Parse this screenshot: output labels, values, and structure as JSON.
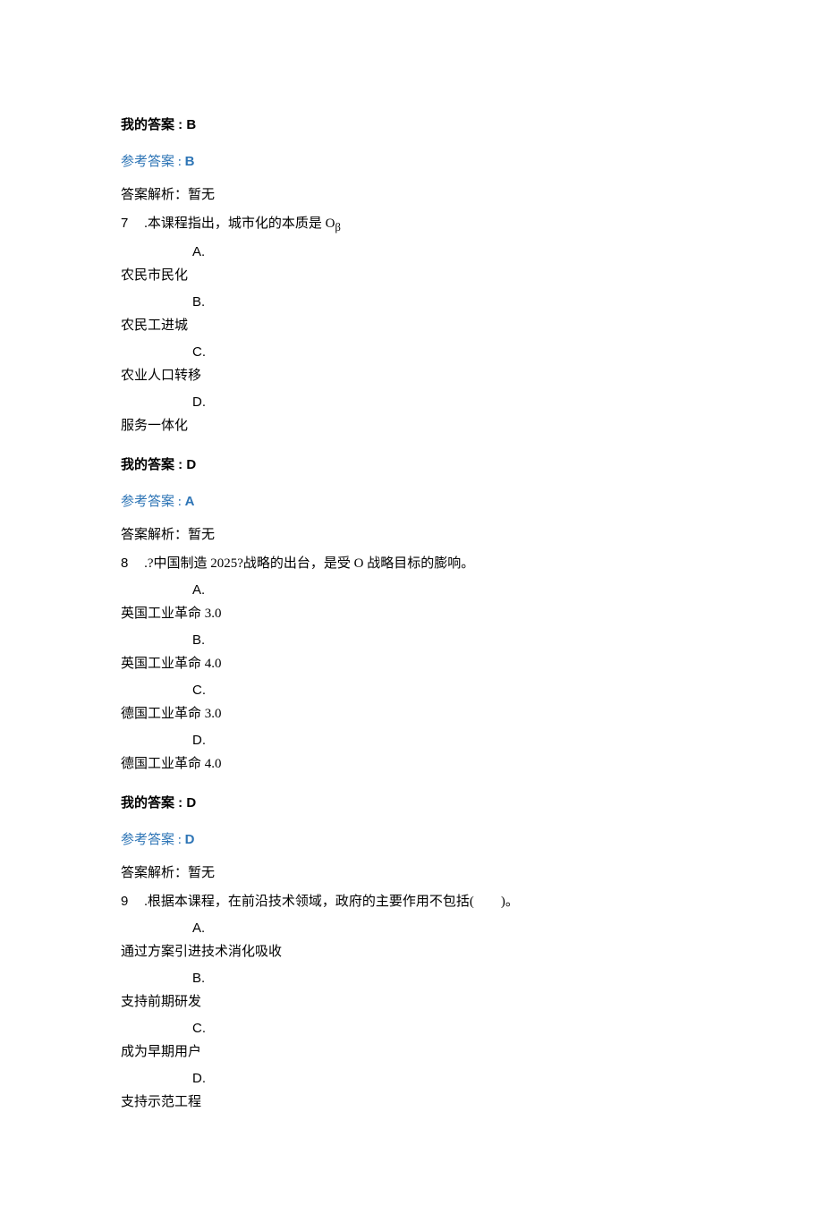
{
  "labels": {
    "my_answer": "我的答案 : ",
    "ref_answer": "参考答案 : ",
    "analysis_prefix": "答案解析：",
    "analysis_value": "暂无"
  },
  "q6": {
    "my_answer": "B",
    "ref_answer": "B"
  },
  "q7": {
    "num": "7",
    "stem_pre": "  .本课程指出，城市化的本质是 O",
    "stem_sub": "β",
    "options": {
      "A": {
        "letter": "A.",
        "text": "农民市民化"
      },
      "B": {
        "letter": "B.",
        "text": "农民工进城"
      },
      "C": {
        "letter": "C.",
        "text": "农业人口转移"
      },
      "D": {
        "letter": "D.",
        "text": "服务一体化"
      }
    },
    "my_answer": "D",
    "ref_answer": "A"
  },
  "q8": {
    "num": "8",
    "stem": "  .?中国制造 2025?战略的出台，是受 O 战略目标的膨响。",
    "options": {
      "A": {
        "letter": "A.",
        "text": "英国工业革命 3.0"
      },
      "B": {
        "letter": "B.",
        "text": "英国工业革命 4.0"
      },
      "C": {
        "letter": "C.",
        "text": "德国工业革命 3.0"
      },
      "D": {
        "letter": "D.",
        "text": "德国工业革命 4.0"
      }
    },
    "my_answer": "D",
    "ref_answer": "D"
  },
  "q9": {
    "num": "9",
    "stem": "  .根据本课程，在前沿技术领域，政府的主要作用不包括(  )。",
    "options": {
      "A": {
        "letter": "A.",
        "text": "通过方案引进技术消化吸收"
      },
      "B": {
        "letter": "B.",
        "text": "支持前期研发"
      },
      "C": {
        "letter": "C.",
        "text": "成为早期用户"
      },
      "D": {
        "letter": "D.",
        "text": "支持示范工程"
      }
    }
  }
}
